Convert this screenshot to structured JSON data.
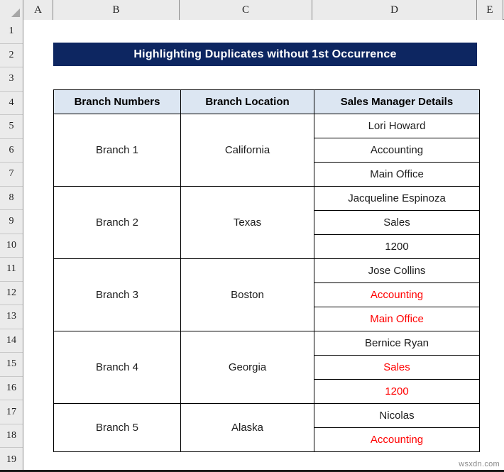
{
  "app": {
    "type": "spreadsheet",
    "watermark": "wsxdn.com"
  },
  "grid": {
    "select_all_icon": "select-all-triangle-icon",
    "column_headers": [
      "A",
      "B",
      "C",
      "D",
      "E"
    ],
    "row_headers": [
      "1",
      "2",
      "3",
      "4",
      "5",
      "6",
      "7",
      "8",
      "9",
      "10",
      "11",
      "12",
      "13",
      "14",
      "15",
      "16",
      "17",
      "18",
      "19"
    ]
  },
  "banner": {
    "title": "Highlighting Duplicates without 1st Occurrence",
    "background_color": "#0D2661",
    "text_color": "#FFFFFF"
  },
  "table": {
    "header_background": "#DCE6F2",
    "duplicate_text_color": "#FF0000",
    "normal_text_color": "#1C1C1C",
    "columns": [
      "Branch Numbers",
      "Branch Location",
      "Sales Manager Details"
    ],
    "groups": [
      {
        "branch": "Branch 1",
        "location": "California",
        "details": [
          {
            "value": "Lori Howard",
            "duplicate": false
          },
          {
            "value": "Accounting",
            "duplicate": false
          },
          {
            "value": "Main Office",
            "duplicate": false
          }
        ]
      },
      {
        "branch": "Branch 2",
        "location": "Texas",
        "details": [
          {
            "value": "Jacqueline Espinoza",
            "duplicate": false
          },
          {
            "value": "Sales",
            "duplicate": false
          },
          {
            "value": "1200",
            "duplicate": false
          }
        ]
      },
      {
        "branch": "Branch 3",
        "location": "Boston",
        "details": [
          {
            "value": "Jose Collins",
            "duplicate": false
          },
          {
            "value": "Accounting",
            "duplicate": true
          },
          {
            "value": "Main Office",
            "duplicate": true
          }
        ]
      },
      {
        "branch": "Branch 4",
        "location": "Georgia",
        "details": [
          {
            "value": "Bernice Ryan",
            "duplicate": false
          },
          {
            "value": "Sales",
            "duplicate": true
          },
          {
            "value": "1200",
            "duplicate": true
          }
        ]
      },
      {
        "branch": "Branch 5",
        "location": "Alaska",
        "details": [
          {
            "value": "Nicolas",
            "duplicate": false
          },
          {
            "value": "Accounting",
            "duplicate": true
          }
        ]
      }
    ]
  }
}
